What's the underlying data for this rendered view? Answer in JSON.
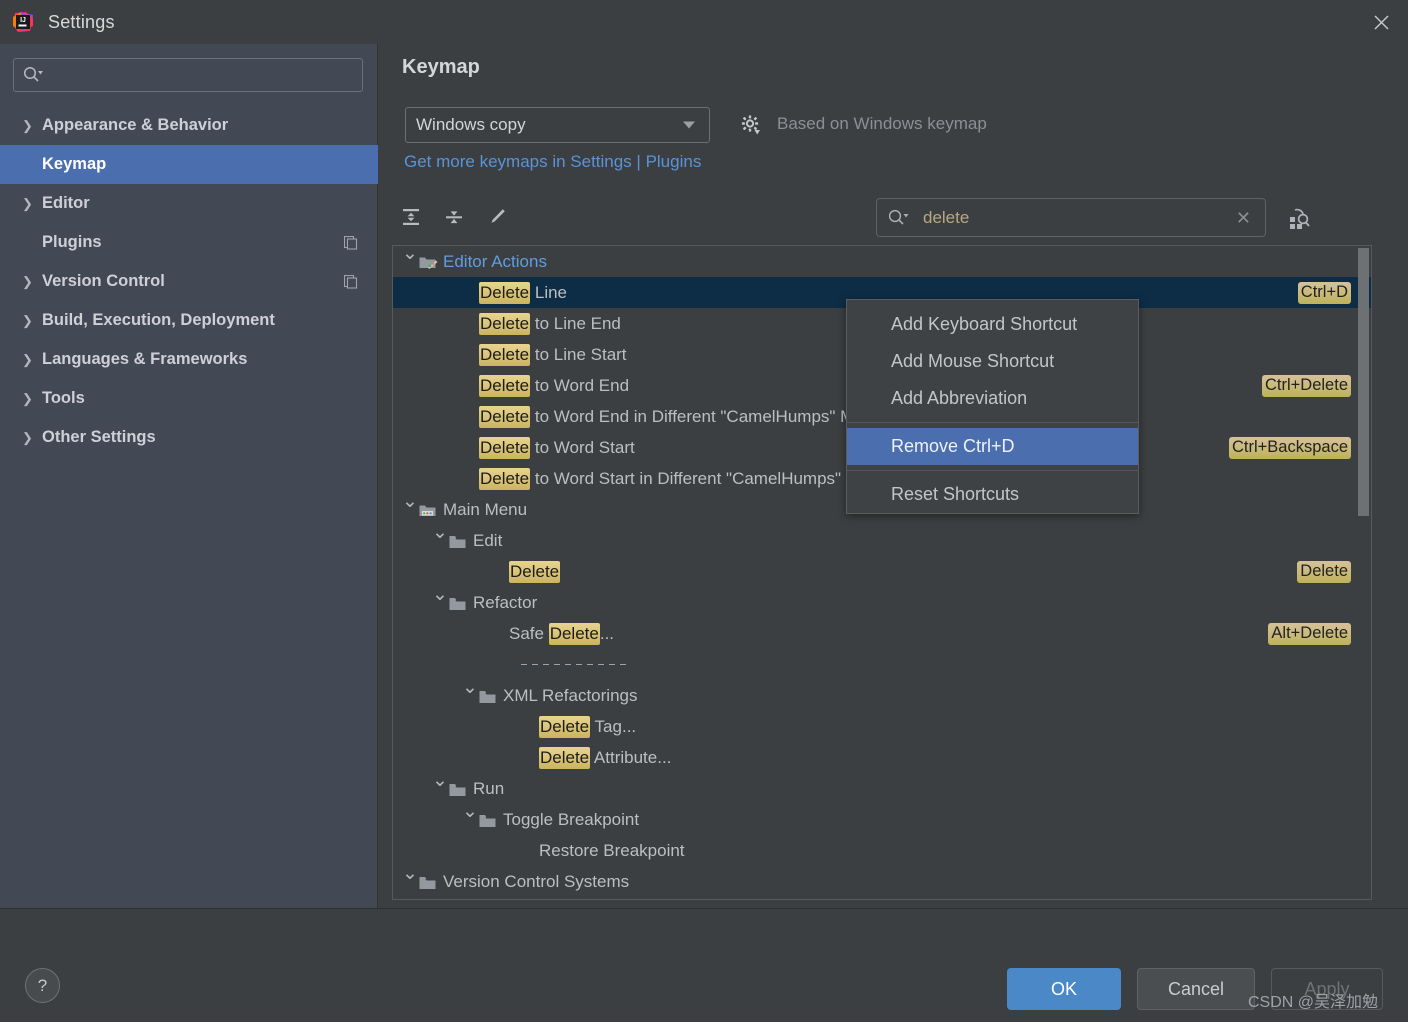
{
  "window": {
    "title": "Settings",
    "logo_icon": "intellij-idea-logo",
    "close_icon": "close-icon"
  },
  "sidebar": {
    "search": {
      "placeholder": "",
      "value": "",
      "icon": "search-icon"
    },
    "items": [
      {
        "label": "Appearance & Behavior",
        "expandable": true,
        "selected": false,
        "badge": null
      },
      {
        "label": "Keymap",
        "expandable": false,
        "selected": true,
        "badge": null
      },
      {
        "label": "Editor",
        "expandable": true,
        "selected": false,
        "badge": null
      },
      {
        "label": "Plugins",
        "expandable": false,
        "selected": false,
        "badge": "copy-icon"
      },
      {
        "label": "Version Control",
        "expandable": true,
        "selected": false,
        "badge": "copy-icon"
      },
      {
        "label": "Build, Execution, Deployment",
        "expandable": true,
        "selected": false,
        "badge": null
      },
      {
        "label": "Languages & Frameworks",
        "expandable": true,
        "selected": false,
        "badge": null
      },
      {
        "label": "Tools",
        "expandable": true,
        "selected": false,
        "badge": null
      },
      {
        "label": "Other Settings",
        "expandable": true,
        "selected": false,
        "badge": null
      }
    ]
  },
  "main": {
    "page_title": "Keymap",
    "keymap_select": {
      "value": "Windows copy",
      "caret_icon": "chevron-down-icon"
    },
    "gear_icon": "gear-icon",
    "based_on": "Based on Windows keymap",
    "plugins_link": "Get more keymaps in Settings | Plugins",
    "toolbar": {
      "expand_all_icon": "expand-all-icon",
      "collapse_all_icon": "collapse-all-icon",
      "edit_icon": "pencil-icon",
      "find_shortcut_icon": "find-by-shortcut-icon"
    },
    "search": {
      "value": "delete",
      "placeholder": "",
      "icon": "search-icon",
      "clear_icon": "clear-icon"
    },
    "tree": [
      {
        "indent": 0,
        "twisty": "v",
        "icon": "editor-actions-folder-icon",
        "pre": "",
        "hl": "",
        "post": "Editor Actions",
        "blue": true,
        "shortcut": "",
        "selected": false,
        "dashed": false
      },
      {
        "indent": 2,
        "twisty": "",
        "icon": "",
        "pre": "",
        "hl": "Delete",
        "post": " Line",
        "blue": false,
        "shortcut": "Ctrl+D",
        "selected": true,
        "dashed": false
      },
      {
        "indent": 2,
        "twisty": "",
        "icon": "",
        "pre": "",
        "hl": "Delete",
        "post": " to Line End",
        "blue": false,
        "shortcut": "",
        "selected": false,
        "dashed": false
      },
      {
        "indent": 2,
        "twisty": "",
        "icon": "",
        "pre": "",
        "hl": "Delete",
        "post": " to Line Start",
        "blue": false,
        "shortcut": "",
        "selected": false,
        "dashed": false
      },
      {
        "indent": 2,
        "twisty": "",
        "icon": "",
        "pre": "",
        "hl": "Delete",
        "post": " to Word End",
        "blue": false,
        "shortcut": "Ctrl+Delete",
        "selected": false,
        "dashed": false
      },
      {
        "indent": 2,
        "twisty": "",
        "icon": "",
        "pre": "",
        "hl": "Delete",
        "post": " to Word End in Different \"CamelHumps\" Mode",
        "blue": false,
        "shortcut": "",
        "selected": false,
        "dashed": false
      },
      {
        "indent": 2,
        "twisty": "",
        "icon": "",
        "pre": "",
        "hl": "Delete",
        "post": " to Word Start",
        "blue": false,
        "shortcut": "Ctrl+Backspace",
        "selected": false,
        "dashed": false
      },
      {
        "indent": 2,
        "twisty": "",
        "icon": "",
        "pre": "",
        "hl": "Delete",
        "post": " to Word Start in Different \"CamelHumps\" Mode",
        "blue": false,
        "shortcut": "",
        "selected": false,
        "dashed": false
      },
      {
        "indent": 0,
        "twisty": "v",
        "icon": "main-menu-folder-icon",
        "pre": "",
        "hl": "",
        "post": "Main Menu",
        "blue": false,
        "shortcut": "",
        "selected": false,
        "dashed": false
      },
      {
        "indent": 1,
        "twisty": "v",
        "icon": "folder-icon",
        "pre": "",
        "hl": "",
        "post": "Edit",
        "blue": false,
        "shortcut": "",
        "selected": false,
        "dashed": false
      },
      {
        "indent": 3,
        "twisty": "",
        "icon": "",
        "pre": "",
        "hl": "Delete",
        "post": "",
        "blue": false,
        "shortcut": "Delete",
        "selected": false,
        "dashed": false
      },
      {
        "indent": 1,
        "twisty": "v",
        "icon": "folder-icon",
        "pre": "",
        "hl": "",
        "post": "Refactor",
        "blue": false,
        "shortcut": "",
        "selected": false,
        "dashed": false
      },
      {
        "indent": 3,
        "twisty": "",
        "icon": "",
        "pre": "Safe ",
        "hl": "Delete",
        "post": "...",
        "blue": false,
        "shortcut": "Alt+Delete",
        "selected": false,
        "dashed": false
      },
      {
        "indent": 3,
        "twisty": "",
        "icon": "",
        "pre": "",
        "hl": "",
        "post": "",
        "blue": false,
        "shortcut": "",
        "selected": false,
        "dashed": true
      },
      {
        "indent": 2,
        "twisty": "v",
        "icon": "folder-icon",
        "pre": "",
        "hl": "",
        "post": "XML Refactorings",
        "blue": false,
        "shortcut": "",
        "selected": false,
        "dashed": false
      },
      {
        "indent": 4,
        "twisty": "",
        "icon": "",
        "pre": "",
        "hl": "Delete",
        "post": " Tag...",
        "blue": false,
        "shortcut": "",
        "selected": false,
        "dashed": false
      },
      {
        "indent": 4,
        "twisty": "",
        "icon": "",
        "pre": "",
        "hl": "Delete",
        "post": " Attribute...",
        "blue": false,
        "shortcut": "",
        "selected": false,
        "dashed": false
      },
      {
        "indent": 1,
        "twisty": "v",
        "icon": "folder-icon",
        "pre": "",
        "hl": "",
        "post": "Run",
        "blue": false,
        "shortcut": "",
        "selected": false,
        "dashed": false
      },
      {
        "indent": 2,
        "twisty": "v",
        "icon": "folder-icon",
        "pre": "",
        "hl": "",
        "post": "Toggle Breakpoint",
        "blue": false,
        "shortcut": "",
        "selected": false,
        "dashed": false
      },
      {
        "indent": 4,
        "twisty": "",
        "icon": "",
        "pre": "",
        "hl": "",
        "post": "Restore Breakpoint",
        "blue": false,
        "shortcut": "",
        "selected": false,
        "dashed": false
      },
      {
        "indent": 0,
        "twisty": "v",
        "icon": "folder-icon",
        "pre": "",
        "hl": "",
        "post": "Version Control Systems",
        "blue": false,
        "shortcut": "",
        "selected": false,
        "dashed": false
      }
    ]
  },
  "context_menu": {
    "items": [
      {
        "label": "Add Keyboard Shortcut",
        "active": false,
        "separator_after": false
      },
      {
        "label": "Add Mouse Shortcut",
        "active": false,
        "separator_after": false
      },
      {
        "label": "Add Abbreviation",
        "active": false,
        "separator_after": true
      },
      {
        "label": "Remove Ctrl+D",
        "active": true,
        "separator_after": true
      },
      {
        "label": "Reset Shortcuts",
        "active": false,
        "separator_after": false
      }
    ]
  },
  "footer": {
    "help_label": "?",
    "ok_label": "OK",
    "cancel_label": "Cancel",
    "apply_label": "Apply",
    "watermark": "CSDN @吴泽加勉"
  },
  "colors": {
    "accent_blue": "#4b6eaf",
    "link_blue": "#5a93d8",
    "selection_row": "#0d2d47",
    "highlight_gold": "#cbb45e",
    "sidebar_bg": "#434855",
    "panel_bg": "#3c3f41"
  }
}
